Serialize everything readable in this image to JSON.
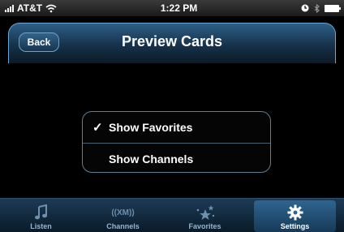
{
  "status_bar": {
    "carrier": "AT&T",
    "time": "1:22 PM"
  },
  "nav": {
    "title": "Preview Cards",
    "back_label": "Back"
  },
  "options": [
    {
      "label": "Show Favorites",
      "checked": true
    },
    {
      "label": "Show Channels",
      "checked": false
    }
  ],
  "check_glyph": "✓",
  "tabs": [
    {
      "label": "Listen",
      "icon": "music-note-icon",
      "active": false
    },
    {
      "label": "Channels",
      "icon": "xm-signal-icon",
      "glyph": "((XM))",
      "active": false
    },
    {
      "label": "Favorites",
      "icon": "stars-icon",
      "active": false
    },
    {
      "label": "Settings",
      "icon": "gear-icon",
      "active": true
    }
  ],
  "colors": {
    "nav_gradient_top": "#2d5f86",
    "nav_border": "#6aa6d6",
    "tab_active": "#2f6590"
  }
}
